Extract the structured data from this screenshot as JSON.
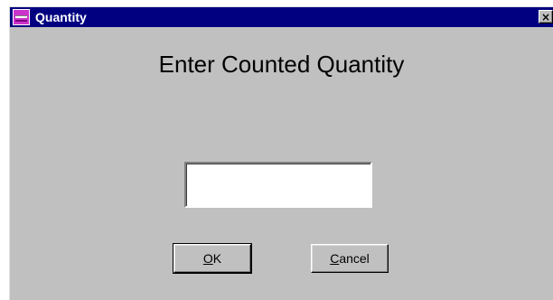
{
  "window": {
    "title": "Quantity",
    "close_glyph": "×",
    "icon": "app-window-icon"
  },
  "dialog": {
    "heading": "Enter Counted Quantity",
    "quantity_value": ""
  },
  "buttons": {
    "ok": {
      "accel": "O",
      "rest": "K"
    },
    "cancel": {
      "accel": "C",
      "rest": "ancel"
    }
  },
  "colors": {
    "titlebar": "#000080",
    "face": "#c0c0c0",
    "icon_magenta": "#cc33cc"
  }
}
